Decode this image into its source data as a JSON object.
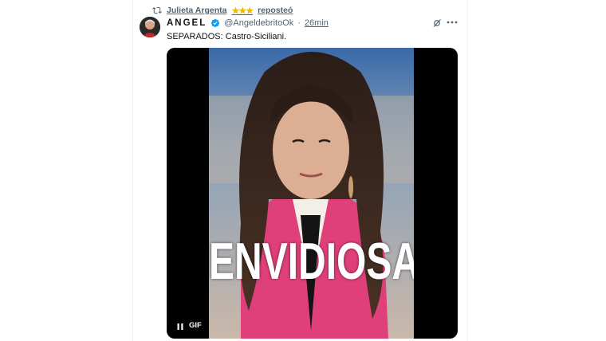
{
  "repost": {
    "name": "Julieta Argenta",
    "stars": "★★★",
    "verb": "reposteó"
  },
  "tweet": {
    "display_name": "ANGEL",
    "handle": "@AngeldebritoOk",
    "separator": "·",
    "time": "26min",
    "text": "SEPARADOS: Castro-Siciliani."
  },
  "media": {
    "caption": "ENVIDIOSA",
    "badge": "GIF"
  },
  "icons": {
    "repost": "repost-icon",
    "verified": "verified-badge-icon",
    "grok": "grok-icon",
    "more": "more-icon",
    "pause": "pause-icon"
  },
  "colors": {
    "verified": "#1d9bf0",
    "stars": "#f5b400",
    "secondary_text": "#536471",
    "blazer_pink": "#e0407a"
  }
}
